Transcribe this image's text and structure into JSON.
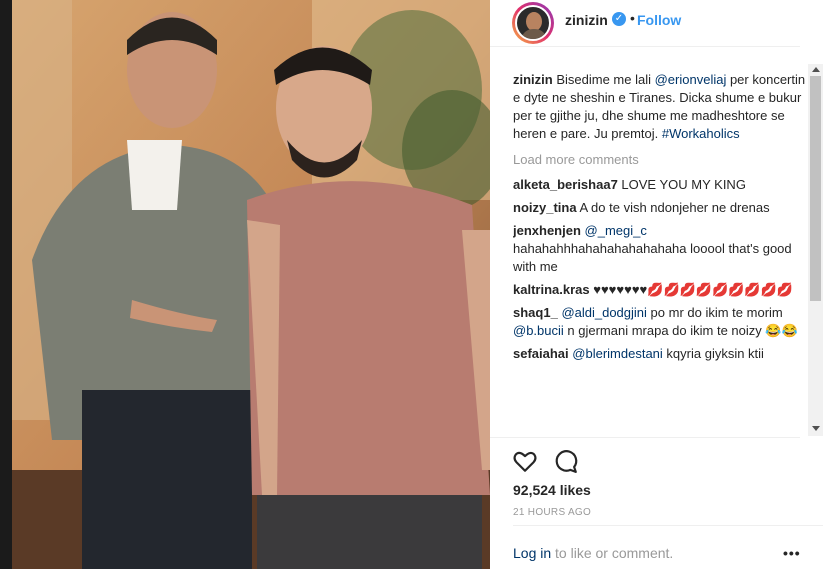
{
  "post": {
    "image_alt": "Two men posing for a photo indoors",
    "header": {
      "username": "zinizin",
      "separator": "•",
      "follow_label": "Follow",
      "verified_icon": "verified-badge-icon"
    },
    "caption": {
      "username": "zinizin",
      "text_before": "Bisedime me lali ",
      "mention": "@erionveliaj",
      "text_after": " per koncertin e dyte ne sheshin e Tiranes. Dicka shume e bukur per te gjithe ju, dhe shume me madheshtore se heren e pare. Ju premtoj. ",
      "hashtag": "#Workaholics"
    },
    "load_more": "Load more comments",
    "comments": [
      {
        "user": "alketa_berishaa7",
        "text": "LOVE YOU MY KING"
      },
      {
        "user": "noizy_tina",
        "text": "A do te vish ndonjeher ne drenas"
      },
      {
        "user": "jenxhenjen",
        "mention": "@_megi_c",
        "text": "hahahahhhahahahahahahaha looool that's good with me"
      },
      {
        "user": "kaltrina.kras",
        "text": "♥♥♥♥♥♥♥💋💋💋💋💋💋💋💋💋"
      },
      {
        "user": "shaq1_",
        "mention": "@aldi_dodgjini",
        "text": "po mr do ikim te morim",
        "mention2": "@b.bucii",
        "text2": "n gjermani mrapa do ikim te noizy 😂😂"
      },
      {
        "user": "sefaiahai",
        "mention": "@blerimdestani",
        "text": "kqyria giyksin ktii"
      }
    ],
    "likes": "92,524 likes",
    "timestamp": "21 HOURS AGO",
    "login": {
      "link": "Log in",
      "text": "to like or comment."
    },
    "more_options": "•••"
  },
  "colors": {
    "link": "#3897f0",
    "mention": "#003569",
    "muted": "#999999",
    "text": "#262626"
  }
}
